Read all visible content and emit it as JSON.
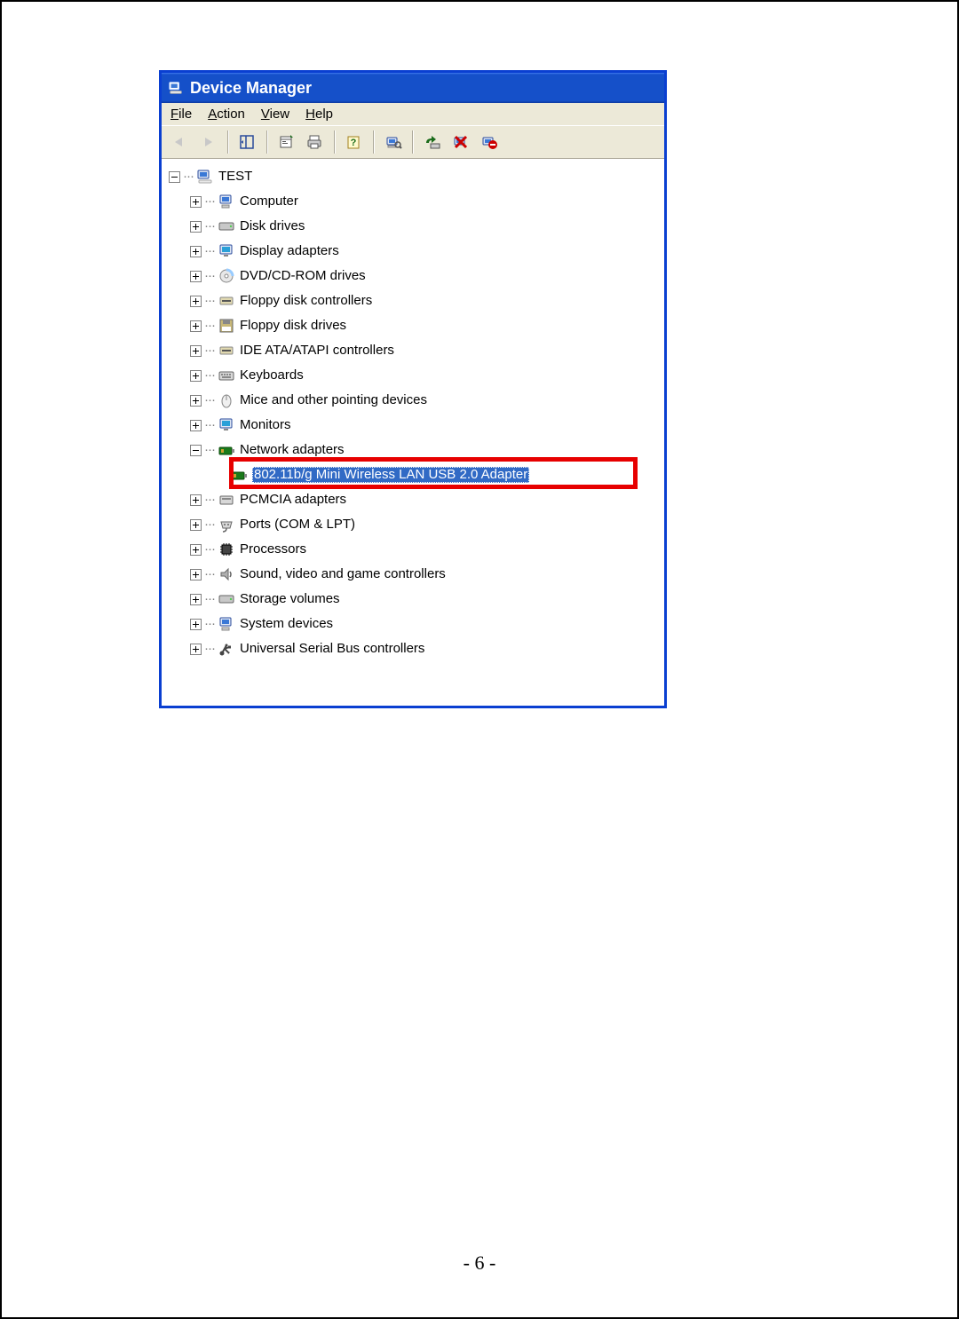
{
  "window": {
    "title": "Device Manager"
  },
  "menu": {
    "file": "File",
    "action": "Action",
    "view": "View",
    "help": "Help"
  },
  "tree": {
    "root": "TEST",
    "items": [
      "Computer",
      "Disk drives",
      "Display adapters",
      "DVD/CD-ROM drives",
      "Floppy disk controllers",
      "Floppy disk drives",
      "IDE ATA/ATAPI controllers",
      "Keyboards",
      "Mice and other pointing devices",
      "Monitors",
      "Network adapters",
      "PCMCIA adapters",
      "Ports (COM & LPT)",
      "Processors",
      "Sound, video and game controllers",
      "Storage volumes",
      "System devices",
      "Universal Serial Bus controllers"
    ],
    "selected_child": "802.11b/g Mini Wireless LAN USB 2.0 Adapter"
  },
  "page_number": "- 6 -"
}
